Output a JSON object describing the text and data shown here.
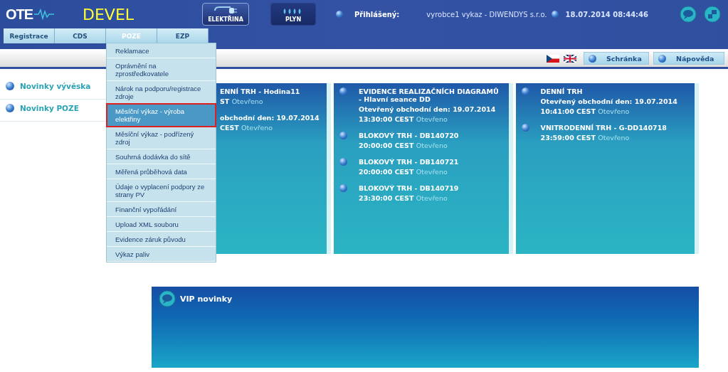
{
  "header": {
    "logo": "OTE",
    "environment": "DEVEL",
    "commodities": [
      {
        "label": "ELEKTŘINA",
        "selected": true
      },
      {
        "label": "PLYN",
        "selected": false
      }
    ],
    "login_label": "Přihlášený:",
    "user": "vyrobce1 vykaz - DIWENDYS s.r.o.",
    "datetime": "18.07.2014 08:44:46"
  },
  "nav_tabs": [
    {
      "label": "Registrace",
      "selected": false
    },
    {
      "label": "CDS",
      "selected": false
    },
    {
      "label": "POZE",
      "selected": true
    },
    {
      "label": "EZP",
      "selected": false
    }
  ],
  "dropdown": [
    {
      "label": "Reklamace",
      "selected": false
    },
    {
      "label": "Oprávnění na zprostředkovatele",
      "selected": false
    },
    {
      "label": "Nárok na podporu/registrace zdroje",
      "selected": false
    },
    {
      "label": "Měsíční výkaz - výroba elektřiny",
      "selected": true
    },
    {
      "label": "Měsíční výkaz - podřízený zdroj",
      "selected": false
    },
    {
      "label": "Souhrná dodávka do sítě",
      "selected": false
    },
    {
      "label": "Měřená průběhová data",
      "selected": false
    },
    {
      "label": "Údaje o vyplacení podpory ze strany PV",
      "selected": false
    },
    {
      "label": "Finanční vypořádání",
      "selected": false
    },
    {
      "label": "Upload XML souboru",
      "selected": false
    },
    {
      "label": "Evidence záruk původu",
      "selected": false
    },
    {
      "label": "Výkaz paliv",
      "selected": false
    }
  ],
  "toolbar": {
    "buttons": [
      "Schránka",
      "Nápověda"
    ]
  },
  "sidebar": {
    "items": [
      "Novinky vývěska",
      "Novinky POZE"
    ]
  },
  "panels": [
    {
      "bullets": false,
      "entries": [
        {
          "title": "ENNÍ TRH - Hodina11",
          "time": "ST",
          "status": "Otevřeno"
        },
        {
          "day": "obchodní den: 19.07.2014",
          "time": "CEST",
          "status": "Otevřeno"
        }
      ]
    },
    {
      "bullets": true,
      "entries": [
        {
          "title": "EVIDENCE REALIZAČNÍCH DIAGRAMŮ - Hlavní seance DD",
          "day": "Otevřený obchodní den: 19.07.2014",
          "time": "13:30:00 CEST",
          "status": "Otevřeno"
        },
        {
          "title": "BLOKOVÝ TRH - DB140720",
          "time": "20:00:00 CEST",
          "status": "Otevřeno"
        },
        {
          "title": "BLOKOVÝ TRH - DB140721",
          "time": "20:00:00 CEST",
          "status": "Otevřeno"
        },
        {
          "title": "BLOKOVÝ TRH - DB140719",
          "time": "23:30:00 CEST",
          "status": "Otevřeno"
        }
      ]
    },
    {
      "bullets": true,
      "entries": [
        {
          "title": "DENNÍ TRH",
          "day": "Otevřený obchodní den: 19.07.2014",
          "time": "10:41:00 CEST",
          "status": "Otevřeno"
        },
        {
          "title": "VNITRODENNÍ TRH - G-DD140718",
          "time": "23:59:00 CEST",
          "status": "Otevřeno"
        }
      ]
    }
  ],
  "vip": {
    "title": "VIP novinky"
  }
}
